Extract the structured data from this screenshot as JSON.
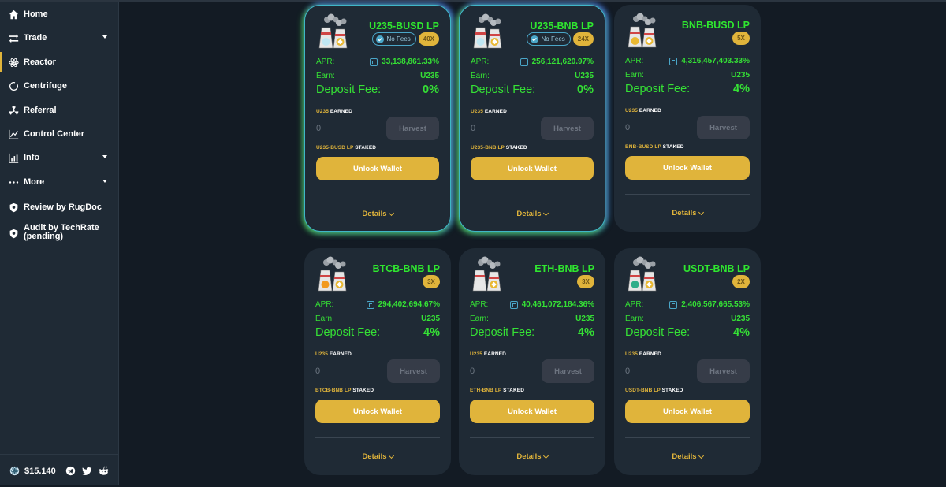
{
  "sidebar": {
    "items": [
      {
        "label": "Home",
        "icon": "home-icon"
      },
      {
        "label": "Trade",
        "icon": "swap-icon"
      },
      {
        "label": "Reactor",
        "icon": "atom-icon"
      },
      {
        "label": "Centrifuge",
        "icon": "ring-icon"
      },
      {
        "label": "Referral",
        "icon": "radiation-icon"
      },
      {
        "label": "Control Center",
        "icon": "line-chart-icon"
      },
      {
        "label": "Info",
        "icon": "bar-chart-icon"
      },
      {
        "label": "More",
        "icon": "more-icon"
      },
      {
        "label": "Review by RugDoc",
        "icon": "shield-icon"
      },
      {
        "label_line1": "Audit by TechRate",
        "label_line2": "(pending)",
        "icon": "shield-icon"
      }
    ],
    "footer": {
      "price": "$15.140"
    }
  },
  "common": {
    "apr_label": "APR:",
    "earn_label": "Earn:",
    "earn_token": "U235",
    "fee_label": "Deposit Fee:",
    "earned_token": "U235",
    "earned_suffix": "EARNED",
    "earned_value": "0",
    "harvest_label": "Harvest",
    "staked_suffix": "STAKED",
    "unlock_label": "Unlock Wallet",
    "details_label": "Details",
    "no_fees_label": "No Fees"
  },
  "farms": [
    {
      "title": "U235-BUSD LP",
      "multiplier": "40X",
      "apr": "33,138,861.33%",
      "fee": "0%",
      "staked_token": "U235-BUSD LP",
      "no_fees": true
    },
    {
      "title": "U235-BNB LP",
      "multiplier": "24X",
      "apr": "256,121,620.97%",
      "fee": "0%",
      "staked_token": "U235-BNB LP",
      "no_fees": true
    },
    {
      "title": "BNB-BUSD LP",
      "multiplier": "5X",
      "apr": "4,316,457,403.33%",
      "fee": "4%",
      "staked_token": "BNB-BUSD LP",
      "no_fees": false
    },
    {
      "title": "BTCB-BNB LP",
      "multiplier": "3X",
      "apr": "294,402,694.67%",
      "fee": "4%",
      "staked_token": "BTCB-BNB LP",
      "no_fees": false
    },
    {
      "title": "ETH-BNB LP",
      "multiplier": "3X",
      "apr": "40,461,072,184.36%",
      "fee": "4%",
      "staked_token": "ETH-BNB LP",
      "no_fees": false
    },
    {
      "title": "USDT-BNB LP",
      "multiplier": "2X",
      "apr": "2,406,567,665.53%",
      "fee": "4%",
      "staked_token": "USDT-BNB LP",
      "no_fees": false
    }
  ],
  "colors": {
    "accent": "#e0b43b",
    "green": "#35e135",
    "card": "#1f2a35",
    "bg": "#131b24"
  }
}
